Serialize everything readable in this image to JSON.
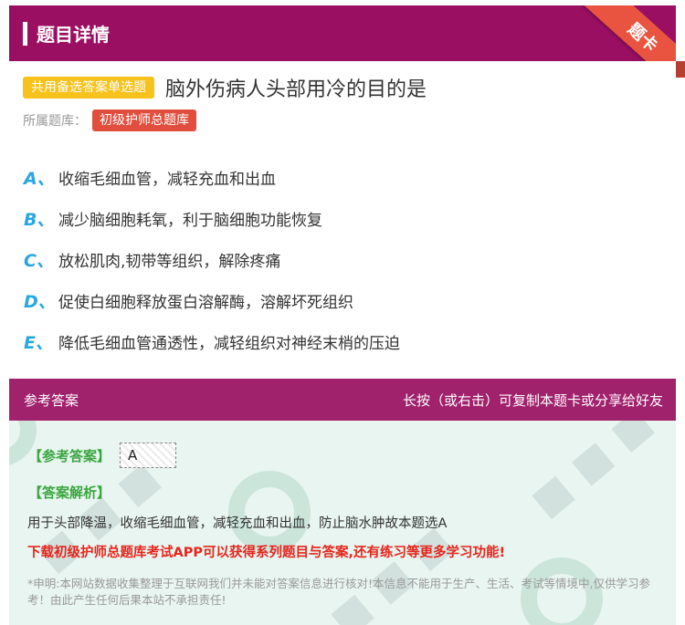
{
  "header": {
    "title": "题目详情",
    "corner_label": "题卡"
  },
  "question": {
    "type_badge": "共用备选答案单选题",
    "text": "脑外伤病人头部用冷的目的是"
  },
  "library": {
    "label": "所属题库：",
    "name": "初级护师总题库"
  },
  "options": [
    {
      "letter": "A、",
      "text": "收缩毛细血管，减轻充血和出血"
    },
    {
      "letter": "B、",
      "text": "减少脑细胞耗氧，利于脑细胞功能恢复"
    },
    {
      "letter": "C、",
      "text": "放松肌肉,韧带等组织，解除疼痛"
    },
    {
      "letter": "D、",
      "text": "促使白细胞释放蛋白溶解酶，溶解坏死组织"
    },
    {
      "letter": "E、",
      "text": "降低毛细血管通透性，减轻组织对神经末梢的压迫"
    }
  ],
  "answer_section": {
    "title": "参考答案",
    "hint": "长按（或右击）可复制本题卡或分享给好友",
    "answer_label": "【参考答案】",
    "answer_value": "A",
    "analysis_label": "【答案解析】",
    "analysis_text": "用于头部降温，收缩毛细血管，减轻充血和出血，防止脑水肿故本题选A",
    "download_text": "下载初级护师总题库考试APP可以获得系列题目与答案,还有练习等更多学习功能!",
    "disclaimer": "*申明:本网站数据收集整理于互联网我们并未能对答案信息进行核对!本信息不能用于生产、生活、考试等情境中,仅供学习参考！由此产生任何后果本站不承担责任!"
  },
  "colors": {
    "header_bg": "#9b0f63",
    "answer_header_bg": "#a0216c",
    "ribbon": "#e8543f",
    "type_badge": "#f7c21c",
    "library_badge": "#e14e3e",
    "option_letter": "#29a7e1",
    "answer_panel_bg": "#e8f5f0",
    "green_label": "#3aa63f",
    "download_text": "#e6251c"
  }
}
